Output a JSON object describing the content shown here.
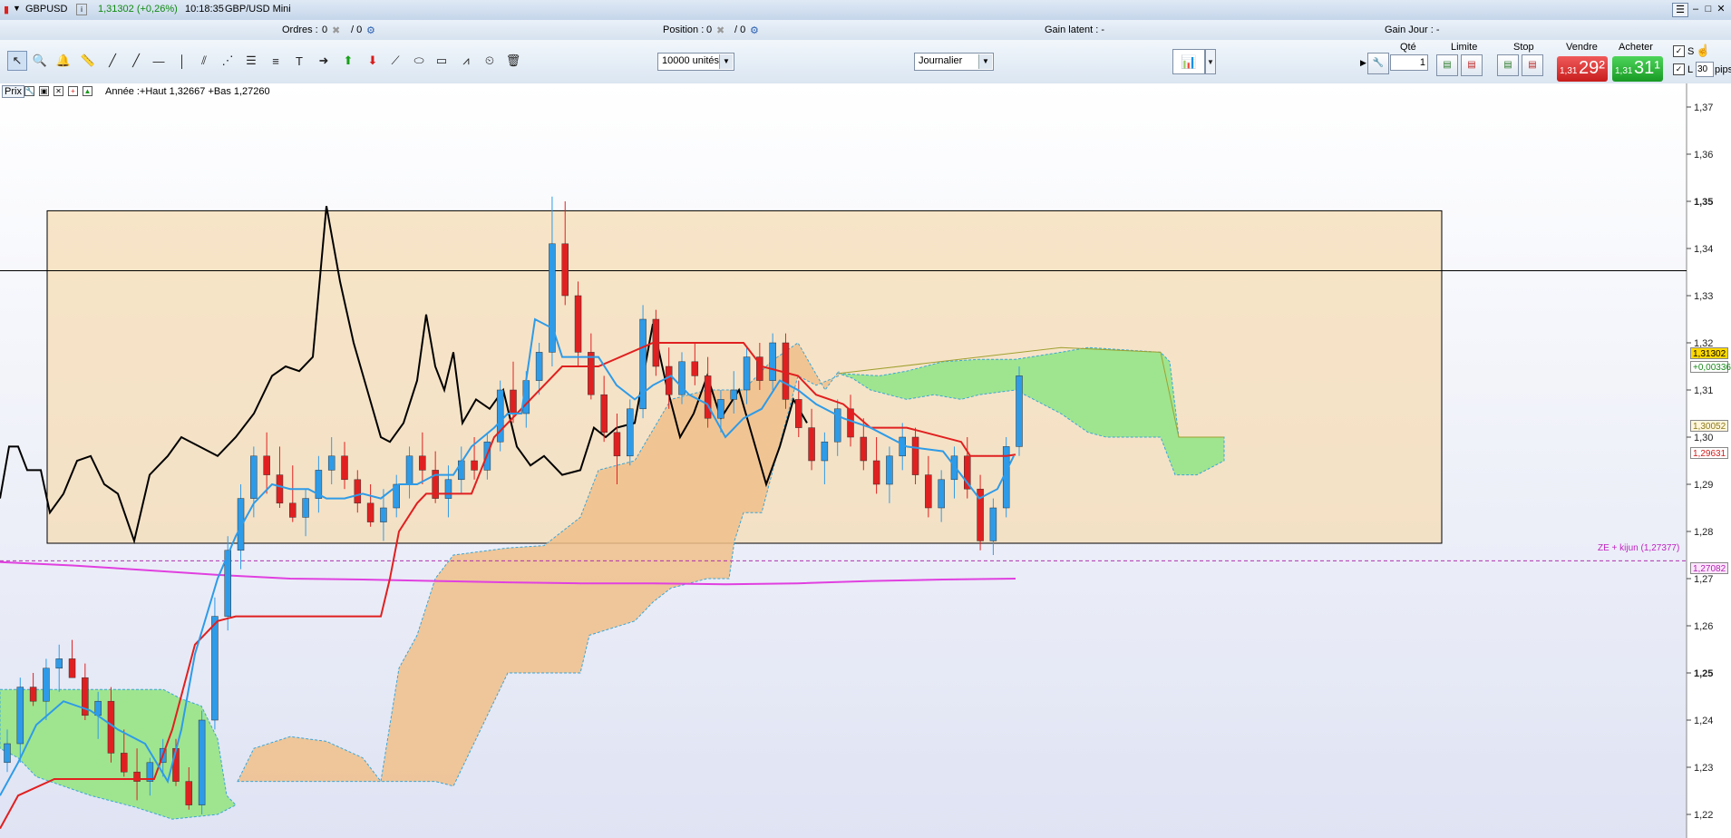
{
  "titlebar": {
    "symbol": "GBPUSD",
    "price_change": "1,31302 (+0,26%)",
    "time": "10:18:35",
    "instrument": "GBP/USD Mini"
  },
  "infobar": {
    "orders_label": "Ordres :",
    "orders_value": "0",
    "orders_total": "/ 0",
    "position_label": "Position :",
    "position_value": "0",
    "position_total": "/ 0",
    "gain_latent": "Gain latent : -",
    "gain_jour": "Gain Jour : -"
  },
  "toolbar": {
    "quantity_select": "10000 unités",
    "period_select": "Journalier"
  },
  "order_panel": {
    "qty_label": "Qté",
    "qty_value": "1",
    "limit_label": "Limite",
    "stop_label": "Stop",
    "sell_label": "Vendre",
    "buy_label": "Acheter",
    "sell_price_small": "1,31",
    "sell_price_big": "29²",
    "buy_price_small": "1,31",
    "buy_price_big": "31¹",
    "s_label": "S",
    "l_label": "L",
    "pips_value": "30",
    "pips_label": "pips"
  },
  "chart_header": {
    "prix_label": "Prix",
    "annotation": "Année :+Haut 1,32667 +Bas 1,27260"
  },
  "price_tags": {
    "last": "1,31302",
    "change": "+0,00336",
    "t1": "1,30052",
    "t2": "1,29631",
    "t3": "1,27082"
  },
  "ze_label": "ZE + kijun (1,27377)",
  "colors": {
    "bull": "#2e9be8",
    "bear": "#e02020",
    "kijun": "#e02020",
    "tenkan": "#2e9be8",
    "chikou": "#000000",
    "kumo_green": "#9fe58f",
    "kumo_orange": "#f0c08a",
    "ma_magenta": "#e040e0",
    "box_fill": "#f7dcb0"
  },
  "chart_data": {
    "type": "candlestick",
    "ylim": [
      1.215,
      1.375
    ],
    "y_ticks": [
      "1,37",
      "1,36",
      "1,35",
      "1,34",
      "1,33",
      "1,32",
      "1,31",
      "1,30",
      "1,29",
      "1,28",
      "1,27",
      "1,26",
      "1,25",
      "1,24",
      "1,23",
      "1,22"
    ],
    "bold_ticks": [
      "1,35",
      "1,25"
    ],
    "candles": [
      [
        1.231,
        1.238,
        1.229,
        1.235
      ],
      [
        1.235,
        1.249,
        1.231,
        1.247
      ],
      [
        1.247,
        1.25,
        1.243,
        1.244
      ],
      [
        1.244,
        1.253,
        1.24,
        1.251
      ],
      [
        1.251,
        1.256,
        1.246,
        1.253
      ],
      [
        1.253,
        1.257,
        1.249,
        1.249
      ],
      [
        1.249,
        1.252,
        1.24,
        1.241
      ],
      [
        1.241,
        1.246,
        1.236,
        1.244
      ],
      [
        1.244,
        1.247,
        1.231,
        1.233
      ],
      [
        1.233,
        1.238,
        1.228,
        1.229
      ],
      [
        1.229,
        1.234,
        1.223,
        1.227
      ],
      [
        1.227,
        1.232,
        1.224,
        1.231
      ],
      [
        1.231,
        1.236,
        1.228,
        1.234
      ],
      [
        1.234,
        1.236,
        1.226,
        1.227
      ],
      [
        1.227,
        1.23,
        1.221,
        1.222
      ],
      [
        1.222,
        1.242,
        1.22,
        1.24
      ],
      [
        1.24,
        1.266,
        1.238,
        1.262
      ],
      [
        1.262,
        1.279,
        1.259,
        1.276
      ],
      [
        1.276,
        1.29,
        1.272,
        1.287
      ],
      [
        1.287,
        1.298,
        1.283,
        1.296
      ],
      [
        1.296,
        1.301,
        1.288,
        1.292
      ],
      [
        1.292,
        1.298,
        1.285,
        1.286
      ],
      [
        1.286,
        1.294,
        1.282,
        1.283
      ],
      [
        1.283,
        1.289,
        1.279,
        1.287
      ],
      [
        1.287,
        1.296,
        1.284,
        1.293
      ],
      [
        1.293,
        1.3,
        1.29,
        1.296
      ],
      [
        1.296,
        1.299,
        1.289,
        1.291
      ],
      [
        1.291,
        1.293,
        1.284,
        1.286
      ],
      [
        1.286,
        1.29,
        1.281,
        1.282
      ],
      [
        1.282,
        1.289,
        1.278,
        1.285
      ],
      [
        1.285,
        1.292,
        1.283,
        1.29
      ],
      [
        1.29,
        1.298,
        1.287,
        1.296
      ],
      [
        1.296,
        1.301,
        1.29,
        1.293
      ],
      [
        1.293,
        1.297,
        1.286,
        1.287
      ],
      [
        1.287,
        1.294,
        1.283,
        1.291
      ],
      [
        1.291,
        1.298,
        1.288,
        1.295
      ],
      [
        1.295,
        1.3,
        1.291,
        1.293
      ],
      [
        1.293,
        1.301,
        1.291,
        1.299
      ],
      [
        1.299,
        1.312,
        1.297,
        1.31
      ],
      [
        1.31,
        1.316,
        1.303,
        1.305
      ],
      [
        1.305,
        1.314,
        1.302,
        1.312
      ],
      [
        1.312,
        1.32,
        1.309,
        1.318
      ],
      [
        1.318,
        1.351,
        1.315,
        1.341
      ],
      [
        1.341,
        1.35,
        1.328,
        1.33
      ],
      [
        1.33,
        1.333,
        1.315,
        1.318
      ],
      [
        1.318,
        1.322,
        1.308,
        1.309
      ],
      [
        1.309,
        1.313,
        1.299,
        1.301
      ],
      [
        1.301,
        1.305,
        1.29,
        1.296
      ],
      [
        1.296,
        1.308,
        1.294,
        1.306
      ],
      [
        1.306,
        1.328,
        1.304,
        1.325
      ],
      [
        1.325,
        1.327,
        1.313,
        1.315
      ],
      [
        1.315,
        1.319,
        1.306,
        1.309
      ],
      [
        1.309,
        1.318,
        1.307,
        1.316
      ],
      [
        1.316,
        1.32,
        1.311,
        1.313
      ],
      [
        1.313,
        1.317,
        1.302,
        1.304
      ],
      [
        1.304,
        1.31,
        1.301,
        1.308
      ],
      [
        1.308,
        1.314,
        1.305,
        1.31
      ],
      [
        1.31,
        1.319,
        1.307,
        1.317
      ],
      [
        1.317,
        1.32,
        1.31,
        1.312
      ],
      [
        1.312,
        1.322,
        1.31,
        1.32
      ],
      [
        1.32,
        1.322,
        1.306,
        1.308
      ],
      [
        1.308,
        1.312,
        1.3,
        1.302
      ],
      [
        1.302,
        1.306,
        1.293,
        1.295
      ],
      [
        1.295,
        1.301,
        1.29,
        1.299
      ],
      [
        1.299,
        1.308,
        1.296,
        1.306
      ],
      [
        1.306,
        1.309,
        1.298,
        1.3
      ],
      [
        1.3,
        1.304,
        1.293,
        1.295
      ],
      [
        1.295,
        1.3,
        1.288,
        1.29
      ],
      [
        1.29,
        1.298,
        1.286,
        1.296
      ],
      [
        1.296,
        1.303,
        1.293,
        1.3
      ],
      [
        1.3,
        1.302,
        1.29,
        1.292
      ],
      [
        1.292,
        1.296,
        1.283,
        1.285
      ],
      [
        1.285,
        1.293,
        1.282,
        1.291
      ],
      [
        1.291,
        1.298,
        1.287,
        1.296
      ],
      [
        1.296,
        1.3,
        1.287,
        1.289
      ],
      [
        1.289,
        1.292,
        1.276,
        1.278
      ],
      [
        1.278,
        1.287,
        1.275,
        1.285
      ],
      [
        1.285,
        1.3,
        1.283,
        1.298
      ],
      [
        1.298,
        1.315,
        1.296,
        1.313
      ]
    ]
  }
}
